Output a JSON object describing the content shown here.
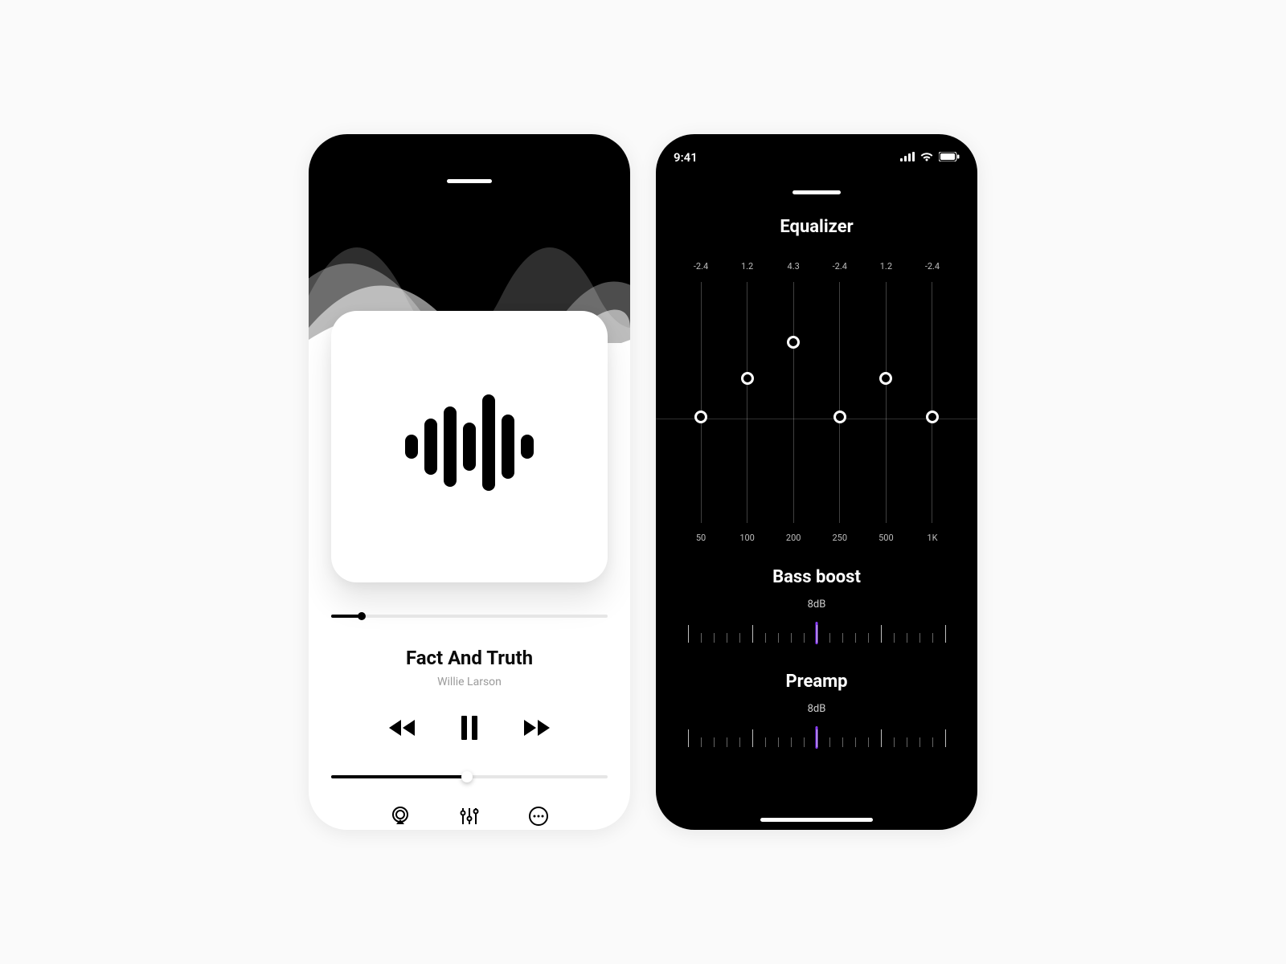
{
  "player": {
    "track_title": "Fact And Truth",
    "track_artist": "Willie Larson",
    "progress_pct": 11,
    "volume_pct": 49
  },
  "status": {
    "time": "9:41"
  },
  "eq": {
    "title": "Equalizer",
    "bands": [
      {
        "value": "-2.4",
        "freq": "50",
        "pos_pct": 56
      },
      {
        "value": "1.2",
        "freq": "100",
        "pos_pct": 40
      },
      {
        "value": "4.3",
        "freq": "200",
        "pos_pct": 25
      },
      {
        "value": "-2.4",
        "freq": "250",
        "pos_pct": 56
      },
      {
        "value": "1.2",
        "freq": "500",
        "pos_pct": 40
      },
      {
        "value": "-2.4",
        "freq": "1K",
        "pos_pct": 56
      }
    ],
    "bass": {
      "title": "Bass boost",
      "value": "8dB"
    },
    "preamp": {
      "title": "Preamp",
      "value": "8dB"
    }
  }
}
